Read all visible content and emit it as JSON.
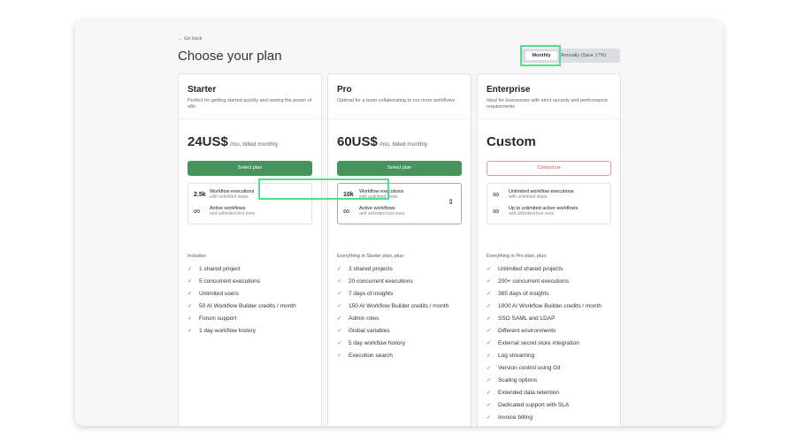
{
  "header": {
    "back_label": "← Go back",
    "title": "Choose your plan"
  },
  "billing_toggle": {
    "monthly_label": "Monthly",
    "annual_label": "Annually (Save 17%)",
    "selected": "Monthly"
  },
  "plans": [
    {
      "name": "Starter",
      "description": "Perfect for getting started quickly and seeing the power of n8n",
      "price": "24US$",
      "price_suffix": "/mo, billed monthly",
      "button_label": "Select plan",
      "exec_count": "2.5k",
      "exec_title": "Workflow executions",
      "exec_sub": "with unlimited steps",
      "wf_icon": "∞",
      "wf_title": "Active workflows",
      "wf_sub": "and unlimited test ones",
      "features_intro": "Includes:",
      "features": [
        "1 shared project",
        "5 concurrent executions",
        "Unlimited users",
        "50 AI Workflow Builder credits / month",
        "Forum support",
        "1 day workflow history"
      ]
    },
    {
      "name": "Pro",
      "description": "Optimal for a team collaborating to run more workflows",
      "price": "60US$",
      "price_suffix": "/mo, billed monthly",
      "button_label": "Select plan",
      "exec_count": "10k",
      "exec_title": "Workflow executions",
      "exec_sub": "with unlimited steps",
      "wf_icon": "∞",
      "wf_title": "Active workflows",
      "wf_sub": "and unlimited test ones",
      "features_intro": "Everything in Starter plan, plus:",
      "features": [
        "3 shared projects",
        "20 concurrent executions",
        "7 days of insights",
        "150 AI Workflow Builder credits / month",
        "Admin roles",
        "Global variables",
        "5 day workflow history",
        "Execution search"
      ]
    },
    {
      "name": "Enterprise",
      "description": "Ideal for businesses with strict security and performance requirements",
      "price": "Custom",
      "price_suffix": "",
      "button_label": "Contact us",
      "exec_icon": "∞",
      "exec_title": "Unlimited workflow executions",
      "exec_sub": "with unlimited steps",
      "wf_icon": "∞",
      "wf_title": "Up to unlimited active workflows",
      "wf_sub": "and unlimited test ones",
      "features_intro": "Everything in Pro plan, plus:",
      "features": [
        "Unlimited shared projects",
        "200+ concurrent executions",
        "365 days of insights",
        "1000 AI Workflow Builder credits / month",
        "SSO SAML and LDAP",
        "Different environments",
        "External secret store integration",
        "Log streaming",
        "Version control using Git",
        "Scaling options",
        "Extended data retention",
        "Dedicated support with SLA",
        "Invoice billing"
      ]
    }
  ],
  "colors": {
    "accent_green": "#46935e",
    "highlight_green": "#4ee18a",
    "contact_red": "#e0503f"
  }
}
